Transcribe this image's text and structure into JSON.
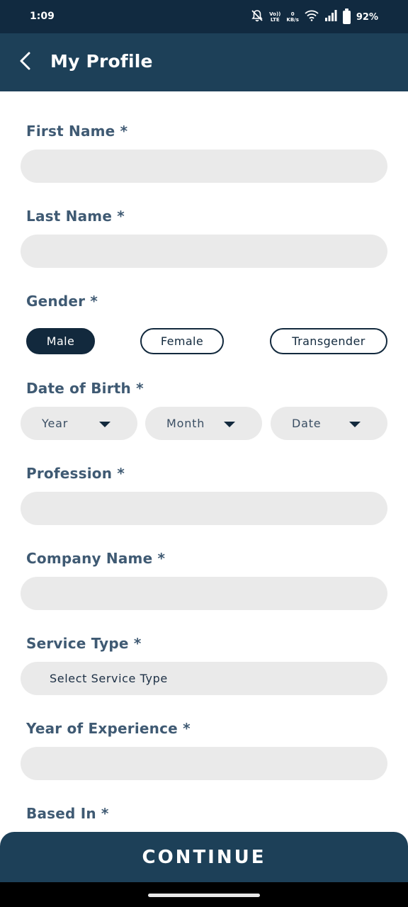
{
  "status_bar": {
    "time": "1:09",
    "volte_top": "Vo))",
    "volte_bottom": "LTE",
    "speed_value": "0",
    "speed_unit": "KB/s",
    "battery": "92%"
  },
  "header": {
    "title": "My Profile",
    "back_icon": "chevron-left-icon"
  },
  "form": {
    "first_name": {
      "label": "First Name *",
      "value": ""
    },
    "last_name": {
      "label": "Last Name *",
      "value": ""
    },
    "gender": {
      "label": "Gender *",
      "options": [
        "Male",
        "Female",
        "Transgender"
      ],
      "selected": "Male"
    },
    "dob": {
      "label": "Date of Birth *",
      "year": "Year",
      "month": "Month",
      "date": "Date"
    },
    "profession": {
      "label": "Profession *",
      "value": ""
    },
    "company_name": {
      "label": "Company Name *",
      "value": ""
    },
    "service_type": {
      "label": "Service Type *",
      "placeholder": "Select Service Type"
    },
    "experience": {
      "label": "Year of Experience *",
      "value": ""
    },
    "based_in": {
      "label": "Based In *"
    }
  },
  "footer": {
    "continue_label": "CONTINUE"
  },
  "colors": {
    "app_bar": "#1d4058",
    "status_bar": "#112a40",
    "primary_dark": "#12293d",
    "label": "#3f5a73",
    "field_bg": "#eaeaea"
  }
}
